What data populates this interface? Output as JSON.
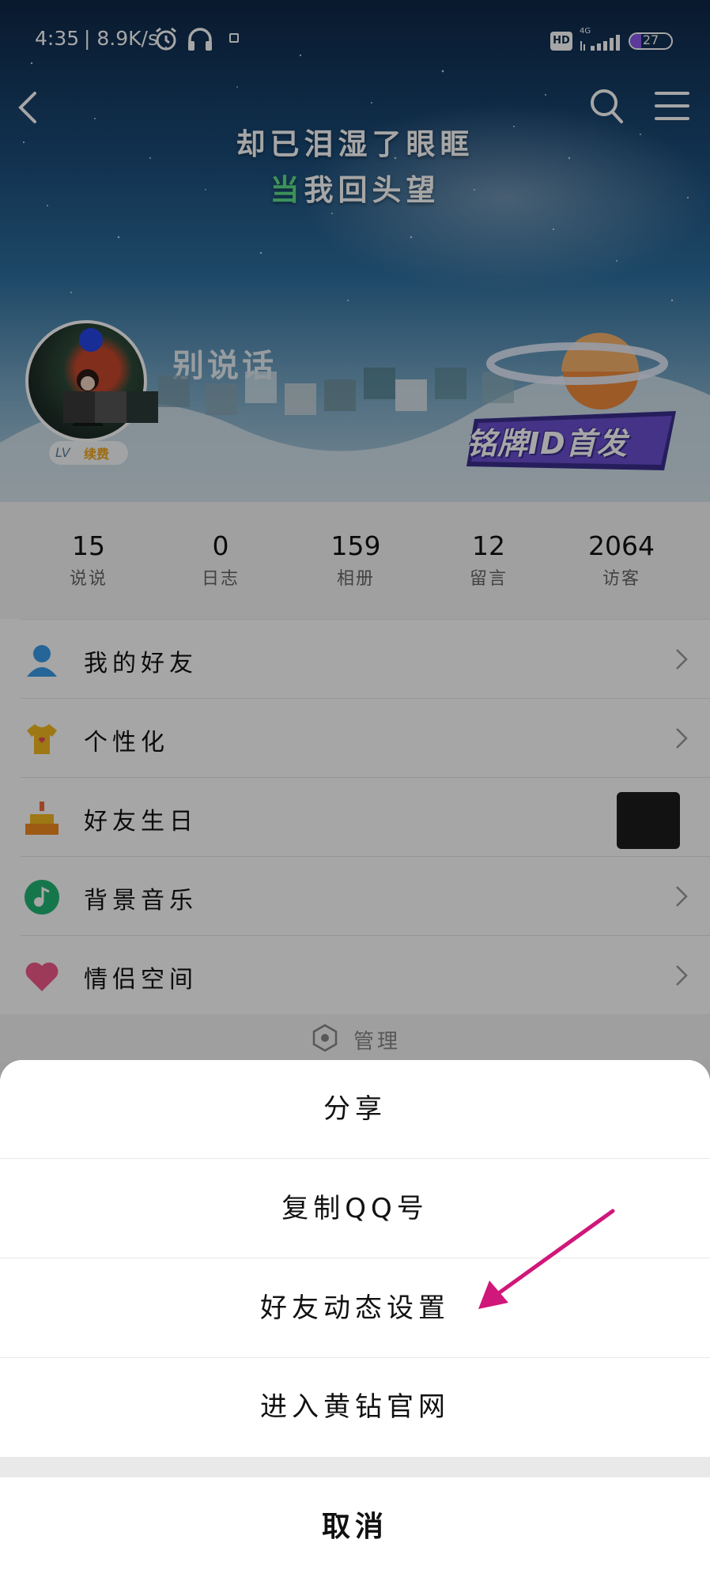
{
  "status_bar": {
    "time": "4:35",
    "network_speed": "| 8.9K/s",
    "hd_label": "HD",
    "network_type": "4G",
    "battery_level": "27",
    "icons": [
      "alarm-icon",
      "headphone-icon",
      "notification-icon",
      "signal-icon",
      "battery-icon"
    ]
  },
  "header": {
    "lyric_line_1": "却已泪湿了眼眶",
    "lyric_line_2_highlight": "当",
    "lyric_line_2_rest": "我回头望",
    "nickname": "别说话",
    "level_text": "LV",
    "level_tag": "续费",
    "promo_text": "铭牌ID首发",
    "icons": [
      "back-icon",
      "search-icon",
      "menu-icon"
    ]
  },
  "stats": [
    {
      "value": "15",
      "label": "说说"
    },
    {
      "value": "0",
      "label": "日志"
    },
    {
      "value": "159",
      "label": "相册"
    },
    {
      "value": "12",
      "label": "留言"
    },
    {
      "value": "2064",
      "label": "访客"
    }
  ],
  "menu": {
    "items": [
      {
        "label": "我的好友",
        "icon": "friends-icon"
      },
      {
        "label": "个性化",
        "icon": "tshirt-icon"
      },
      {
        "label": "好友生日",
        "icon": "cake-icon"
      },
      {
        "label": "背景音乐",
        "icon": "music-icon"
      },
      {
        "label": "情侣空间",
        "icon": "heart-icon"
      }
    ],
    "manage_label": "管理"
  },
  "action_sheet": {
    "options": [
      "分享",
      "复制QQ号",
      "好友动态设置",
      "进入黄钻官网"
    ],
    "cancel_label": "取消"
  },
  "colors": {
    "highlight_green": "#5fe08a",
    "annotation_arrow": "#d0177a",
    "battery_purple": "#8c5af0"
  }
}
